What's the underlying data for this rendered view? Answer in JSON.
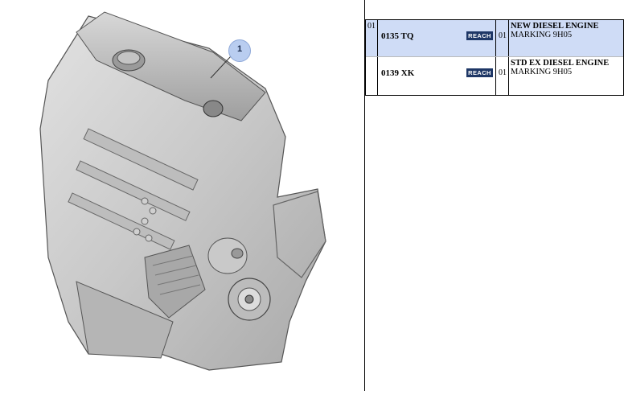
{
  "diagram": {
    "callout_label": "1"
  },
  "table": {
    "rows": [
      {
        "level": "01",
        "reference": "0135 TQ",
        "badge": "REACH",
        "quantity": "01",
        "description_line1": "NEW DIESEL ENGINE",
        "description_line2": "MARKING 9H05",
        "selected": true
      },
      {
        "level": "",
        "reference": "0139 XK",
        "badge": "REACH",
        "quantity": "01",
        "description_line1": "STD EX DIESEL ENGINE",
        "description_line2": "MARKING 9H05",
        "selected": false
      }
    ]
  },
  "colors": {
    "selected_row": "#cfdcf6",
    "badge_bg": "#1e3766",
    "callout_fill": "#b9cdf0"
  }
}
